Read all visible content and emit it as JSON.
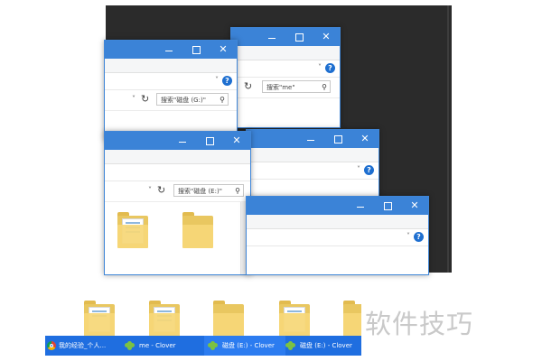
{
  "windows": {
    "me": {
      "search_placeholder": "搜索\"me\""
    },
    "g": {
      "search_placeholder": "搜索\"磁盘 (G:)\""
    },
    "e": {
      "search_placeholder": "搜索\"磁盘 (E:)\""
    }
  },
  "window_controls": {
    "minimize": "─",
    "maximize": "☐",
    "close": "✕"
  },
  "help_glyph": "?",
  "dropdown_glyph": "˅",
  "refresh_glyph": "↻",
  "search_glyph": "⚲",
  "taskbar": {
    "items": [
      {
        "icon": "chrome-icon",
        "label": "我的经验_个人..."
      },
      {
        "icon": "clover-icon",
        "label": "me - Clover"
      },
      {
        "icon": "clover-icon",
        "label": "磁盘 (E:) - Clover"
      },
      {
        "icon": "clover-icon",
        "label": "磁盘 (E:) - Clover"
      }
    ]
  },
  "watermark": "软件技巧",
  "colors": {
    "titlebar": "#3b83d7",
    "taskbar": "#1f6ee0",
    "folder": "#f6d777",
    "desktop_dark": "#2b2b2b"
  }
}
